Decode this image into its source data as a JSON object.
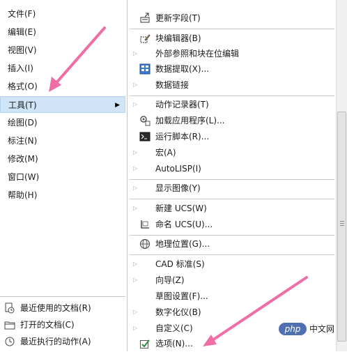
{
  "left_menu": {
    "items": [
      {
        "label": "文件(F)"
      },
      {
        "label": "编辑(E)"
      },
      {
        "label": "视图(V)"
      },
      {
        "label": "插入(I)"
      },
      {
        "label": "格式(O)"
      },
      {
        "label": "工具(T)",
        "selected": true
      },
      {
        "label": "绘图(D)"
      },
      {
        "label": "标注(N)"
      },
      {
        "label": "修改(M)"
      },
      {
        "label": "窗口(W)"
      },
      {
        "label": "帮助(H)"
      }
    ]
  },
  "submenu": {
    "items": {
      "update_fields": "更新字段(T)",
      "block_editor": "块编辑器(B)",
      "xref_edit": "外部参照和块在位编辑",
      "data_extraction": "数据提取(X)...",
      "data_link": "数据链接",
      "action_recorder": "动作记录器(T)",
      "load_application": "加载应用程序(L)...",
      "run_script": "运行脚本(R)...",
      "macro": "宏(A)",
      "autolisp": "AutoLISP(I)",
      "display_image": "显示图像(Y)",
      "new_ucs": "新建 UCS(W)",
      "named_ucs": "命名 UCS(U)...",
      "geo_location": "地理位置(G)...",
      "cad_standards": "CAD 标准(S)",
      "wizards": "向导(Z)",
      "drafting_settings": "草图设置(F)...",
      "digitizer": "数字化仪(B)",
      "customize": "自定义(C)",
      "options": "选项(N)..."
    }
  },
  "bottom_panel": {
    "recent_docs": "最近使用的文档(R)",
    "open_docs": "打开的文档(C)",
    "recent_actions": "最近执行的动作(A)"
  },
  "watermark": {
    "badge": "php",
    "text": "中文网"
  },
  "colors": {
    "selection": "#cfe4f7",
    "annotation_arrow": "#f06ea6"
  }
}
